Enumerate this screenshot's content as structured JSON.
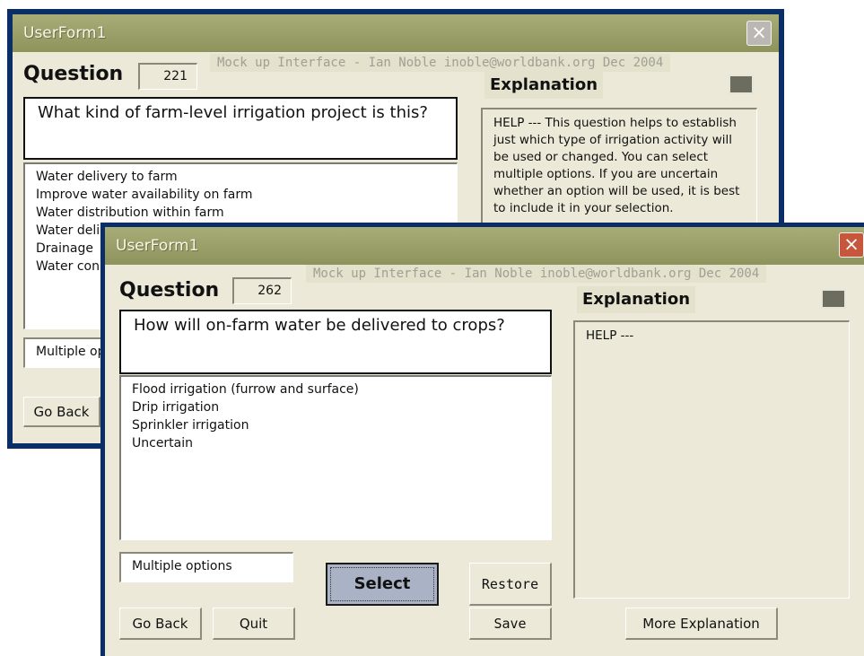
{
  "back_window": {
    "title": "UserForm1",
    "close_glyph": "×",
    "banner": "Mock up Interface - Ian Noble inoble@worldbank.org  Dec 2004",
    "question_label": "Question",
    "question_number": "221",
    "question_text": "What kind of farm-level irrigation project is this?",
    "options": [
      "Water delivery to farm",
      "Improve water availability on farm",
      "Water distribution within farm",
      "Water deli",
      "Drainage",
      "Water con"
    ],
    "explanation_label": "Explanation",
    "help_text": "HELP ---  This question helps to establish just which type of irrigation activity will be used or changed.  You can select multiple options.  If you are uncertain whether an option will be used, it is best to include it in your selection.",
    "multiple_box": "Multiple op",
    "go_back": "Go Back"
  },
  "front_window": {
    "title": "UserForm1",
    "close_glyph": "×",
    "banner": "Mock up Interface - Ian Noble inoble@worldbank.org  Dec 2004",
    "question_label": "Question",
    "question_number": "262",
    "question_text": "How will on-farm water be delivered to crops?",
    "options": [
      "Flood irrigation (furrow and surface)",
      "Drip irrigation",
      "Sprinkler irrigation",
      "Uncertain"
    ],
    "explanation_label": "Explanation",
    "help_text": "HELP ---",
    "multiple_box": "Multiple options",
    "buttons": {
      "select": "Select",
      "restore": "Restore",
      "save": "Save",
      "go_back": "Go Back",
      "quit": "Quit",
      "more_explanation": "More Explanation"
    }
  },
  "colors": {
    "frame": "#0b2e66",
    "titlebar": "#999e68",
    "client": "#ece9d8",
    "close_button": "#c6573c",
    "select_button": "#aab2c6"
  }
}
